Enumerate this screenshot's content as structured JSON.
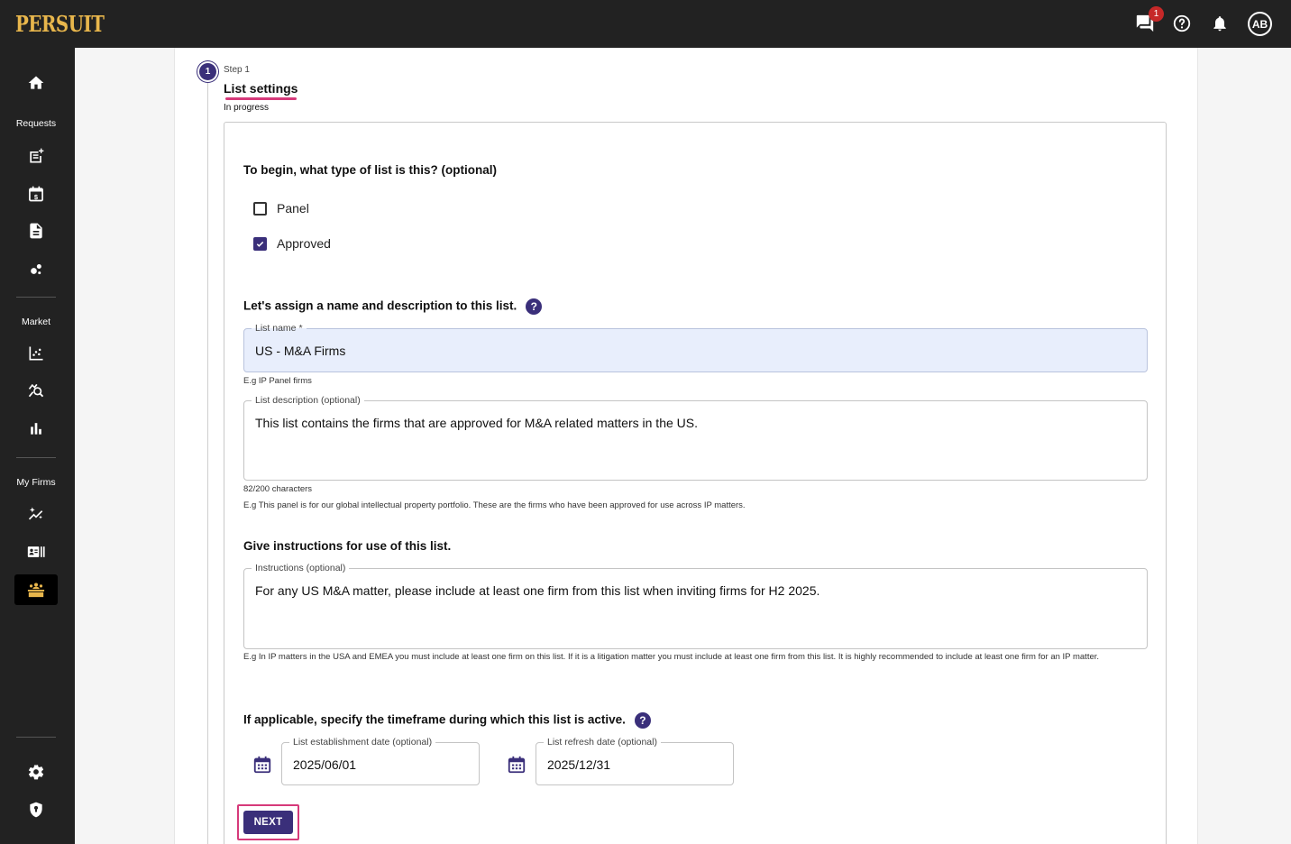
{
  "app": {
    "logo": "PERSUIT",
    "messages_badge": "1",
    "avatar_initials": "AB",
    "brand_color": "#3a2f7a",
    "highlight_color": "#d63a7a"
  },
  "sidebar": {
    "section_requests": "Requests",
    "section_market": "Market",
    "section_my_firms": "My Firms",
    "items": [
      {
        "icon": "home-icon"
      },
      {
        "icon": "new-request-icon"
      },
      {
        "icon": "calendar-dollar-icon"
      },
      {
        "icon": "document-icon"
      },
      {
        "icon": "bubbles-icon"
      },
      {
        "icon": "scatter-chart-icon"
      },
      {
        "icon": "search-analytics-icon"
      },
      {
        "icon": "bar-chart-icon"
      },
      {
        "icon": "sparkle-trend-icon"
      },
      {
        "icon": "contact-card-icon"
      },
      {
        "icon": "firm-lists-icon"
      },
      {
        "icon": "settings-icon"
      },
      {
        "icon": "security-shield-icon"
      }
    ]
  },
  "step": {
    "number": "1",
    "label": "Step 1",
    "title": "List settings",
    "status": "In progress"
  },
  "form": {
    "type_question": "To begin, what type of list is this? (optional)",
    "options": [
      {
        "label": "Panel",
        "checked": false
      },
      {
        "label": "Approved",
        "checked": true
      }
    ],
    "name_question": "Let's assign a name and description to this list.",
    "help_glyph": "?",
    "list_name_label": "List name *",
    "list_name_value": "US - M&A Firms",
    "list_name_hint": "E.g IP Panel firms",
    "description_label": "List description (optional)",
    "description_value": "This list contains the firms that are approved for M&A related matters in the US.",
    "description_count": "82/200 characters",
    "description_hint": "E.g This panel is for our global intellectual property portfolio. These are the firms who have been approved for use across IP matters.",
    "instructions_question": "Give instructions for use of this list.",
    "instructions_label": "Instructions (optional)",
    "instructions_value": "For any US M&A matter, please include at least one firm from this list when inviting firms for H2 2025.",
    "instructions_hint": "E.g In IP matters in the USA and EMEA you must include at least one firm on this list. If it is a litigation matter you must include at least one firm from this list. It is highly recommended to include at least one firm for an IP matter.",
    "timeframe_question": "If applicable, specify the timeframe during which this list is active.",
    "establishment_label": "List establishment date (optional)",
    "establishment_value": "2025/06/01",
    "refresh_label": "List refresh date (optional)",
    "refresh_value": "2025/12/31",
    "next_label": "NEXT"
  }
}
